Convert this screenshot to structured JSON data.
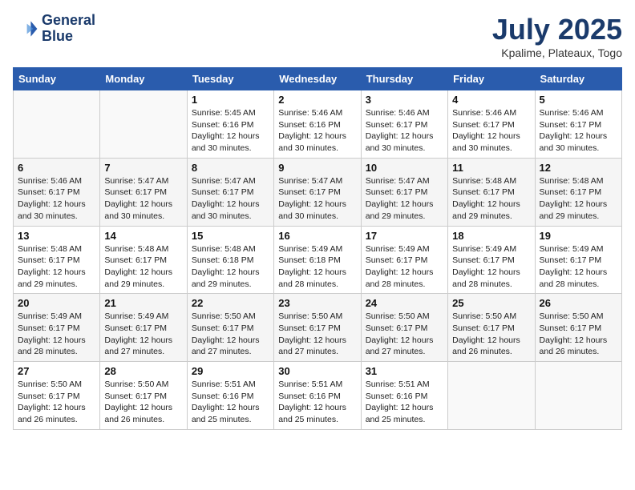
{
  "header": {
    "logo_line1": "General",
    "logo_line2": "Blue",
    "month_year": "July 2025",
    "location": "Kpalime, Plateaux, Togo"
  },
  "days_of_week": [
    "Sunday",
    "Monday",
    "Tuesday",
    "Wednesday",
    "Thursday",
    "Friday",
    "Saturday"
  ],
  "weeks": [
    [
      {
        "day": "",
        "info": ""
      },
      {
        "day": "",
        "info": ""
      },
      {
        "day": "1",
        "info": "Sunrise: 5:45 AM\nSunset: 6:16 PM\nDaylight: 12 hours\nand 30 minutes."
      },
      {
        "day": "2",
        "info": "Sunrise: 5:46 AM\nSunset: 6:16 PM\nDaylight: 12 hours\nand 30 minutes."
      },
      {
        "day": "3",
        "info": "Sunrise: 5:46 AM\nSunset: 6:17 PM\nDaylight: 12 hours\nand 30 minutes."
      },
      {
        "day": "4",
        "info": "Sunrise: 5:46 AM\nSunset: 6:17 PM\nDaylight: 12 hours\nand 30 minutes."
      },
      {
        "day": "5",
        "info": "Sunrise: 5:46 AM\nSunset: 6:17 PM\nDaylight: 12 hours\nand 30 minutes."
      }
    ],
    [
      {
        "day": "6",
        "info": "Sunrise: 5:46 AM\nSunset: 6:17 PM\nDaylight: 12 hours\nand 30 minutes."
      },
      {
        "day": "7",
        "info": "Sunrise: 5:47 AM\nSunset: 6:17 PM\nDaylight: 12 hours\nand 30 minutes."
      },
      {
        "day": "8",
        "info": "Sunrise: 5:47 AM\nSunset: 6:17 PM\nDaylight: 12 hours\nand 30 minutes."
      },
      {
        "day": "9",
        "info": "Sunrise: 5:47 AM\nSunset: 6:17 PM\nDaylight: 12 hours\nand 30 minutes."
      },
      {
        "day": "10",
        "info": "Sunrise: 5:47 AM\nSunset: 6:17 PM\nDaylight: 12 hours\nand 29 minutes."
      },
      {
        "day": "11",
        "info": "Sunrise: 5:48 AM\nSunset: 6:17 PM\nDaylight: 12 hours\nand 29 minutes."
      },
      {
        "day": "12",
        "info": "Sunrise: 5:48 AM\nSunset: 6:17 PM\nDaylight: 12 hours\nand 29 minutes."
      }
    ],
    [
      {
        "day": "13",
        "info": "Sunrise: 5:48 AM\nSunset: 6:17 PM\nDaylight: 12 hours\nand 29 minutes."
      },
      {
        "day": "14",
        "info": "Sunrise: 5:48 AM\nSunset: 6:17 PM\nDaylight: 12 hours\nand 29 minutes."
      },
      {
        "day": "15",
        "info": "Sunrise: 5:48 AM\nSunset: 6:18 PM\nDaylight: 12 hours\nand 29 minutes."
      },
      {
        "day": "16",
        "info": "Sunrise: 5:49 AM\nSunset: 6:18 PM\nDaylight: 12 hours\nand 28 minutes."
      },
      {
        "day": "17",
        "info": "Sunrise: 5:49 AM\nSunset: 6:17 PM\nDaylight: 12 hours\nand 28 minutes."
      },
      {
        "day": "18",
        "info": "Sunrise: 5:49 AM\nSunset: 6:17 PM\nDaylight: 12 hours\nand 28 minutes."
      },
      {
        "day": "19",
        "info": "Sunrise: 5:49 AM\nSunset: 6:17 PM\nDaylight: 12 hours\nand 28 minutes."
      }
    ],
    [
      {
        "day": "20",
        "info": "Sunrise: 5:49 AM\nSunset: 6:17 PM\nDaylight: 12 hours\nand 28 minutes."
      },
      {
        "day": "21",
        "info": "Sunrise: 5:49 AM\nSunset: 6:17 PM\nDaylight: 12 hours\nand 27 minutes."
      },
      {
        "day": "22",
        "info": "Sunrise: 5:50 AM\nSunset: 6:17 PM\nDaylight: 12 hours\nand 27 minutes."
      },
      {
        "day": "23",
        "info": "Sunrise: 5:50 AM\nSunset: 6:17 PM\nDaylight: 12 hours\nand 27 minutes."
      },
      {
        "day": "24",
        "info": "Sunrise: 5:50 AM\nSunset: 6:17 PM\nDaylight: 12 hours\nand 27 minutes."
      },
      {
        "day": "25",
        "info": "Sunrise: 5:50 AM\nSunset: 6:17 PM\nDaylight: 12 hours\nand 26 minutes."
      },
      {
        "day": "26",
        "info": "Sunrise: 5:50 AM\nSunset: 6:17 PM\nDaylight: 12 hours\nand 26 minutes."
      }
    ],
    [
      {
        "day": "27",
        "info": "Sunrise: 5:50 AM\nSunset: 6:17 PM\nDaylight: 12 hours\nand 26 minutes."
      },
      {
        "day": "28",
        "info": "Sunrise: 5:50 AM\nSunset: 6:17 PM\nDaylight: 12 hours\nand 26 minutes."
      },
      {
        "day": "29",
        "info": "Sunrise: 5:51 AM\nSunset: 6:16 PM\nDaylight: 12 hours\nand 25 minutes."
      },
      {
        "day": "30",
        "info": "Sunrise: 5:51 AM\nSunset: 6:16 PM\nDaylight: 12 hours\nand 25 minutes."
      },
      {
        "day": "31",
        "info": "Sunrise: 5:51 AM\nSunset: 6:16 PM\nDaylight: 12 hours\nand 25 minutes."
      },
      {
        "day": "",
        "info": ""
      },
      {
        "day": "",
        "info": ""
      }
    ]
  ]
}
